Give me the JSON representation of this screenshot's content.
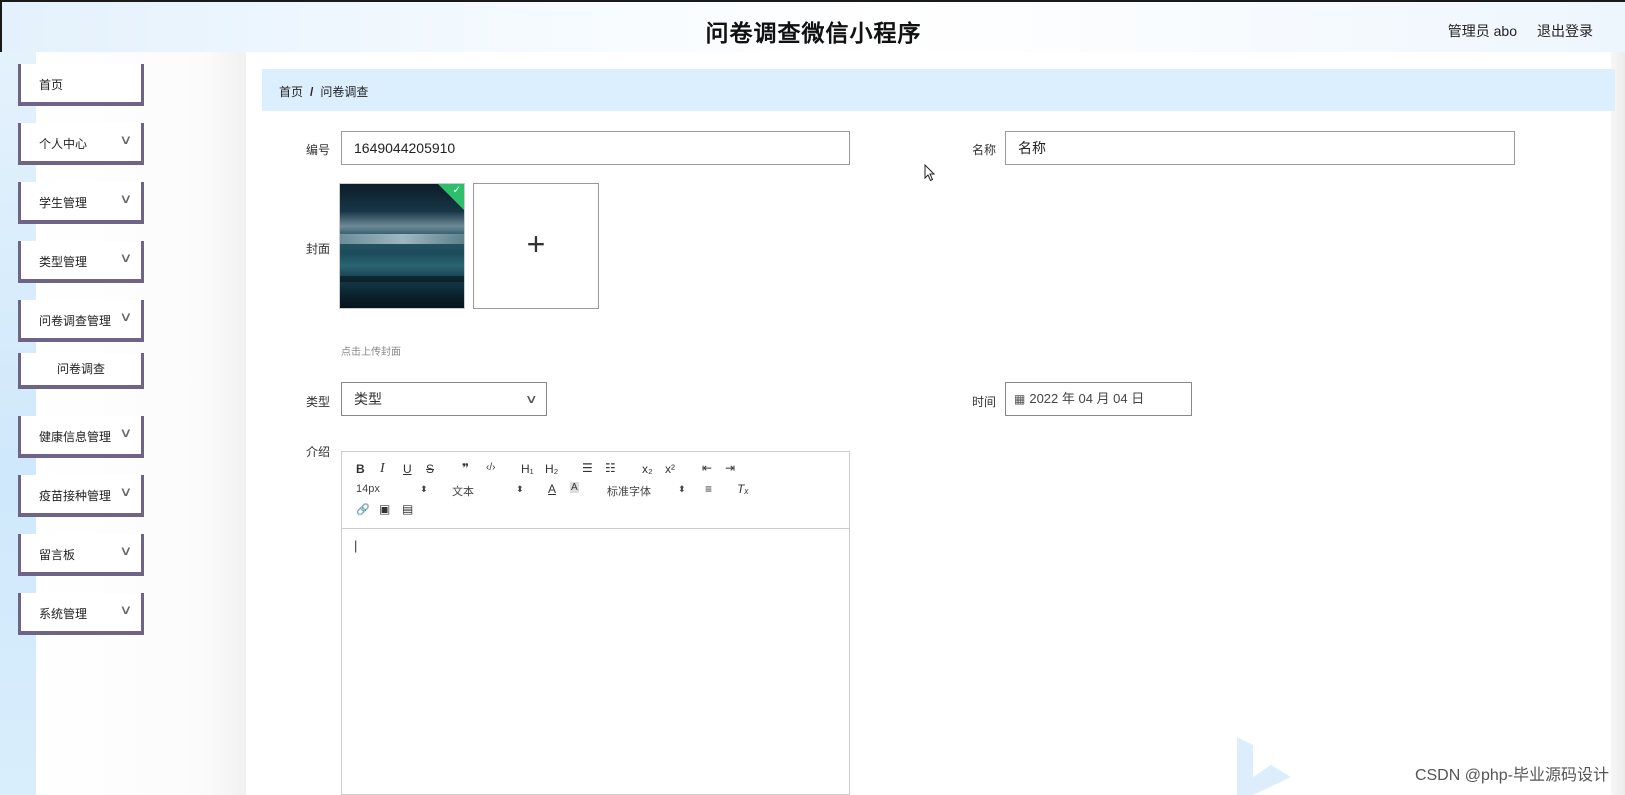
{
  "header": {
    "title": "问卷调查微信小程序",
    "user": "管理员 abo",
    "logout": "退出登录"
  },
  "sidebar": {
    "items": [
      {
        "label": "首页",
        "has_arrow": false
      },
      {
        "label": "个人中心",
        "has_arrow": true
      },
      {
        "label": "学生管理",
        "has_arrow": true
      },
      {
        "label": "类型管理",
        "has_arrow": true
      },
      {
        "label": "问卷调查管理",
        "has_arrow": true
      },
      {
        "label": "健康信息管理",
        "has_arrow": true
      },
      {
        "label": "疫苗接种管理",
        "has_arrow": true
      },
      {
        "label": "留言板",
        "has_arrow": true
      },
      {
        "label": "系统管理",
        "has_arrow": true
      }
    ],
    "submenu": {
      "label": "问卷调查"
    },
    "chevron": "∨"
  },
  "breadcrumb": {
    "home": "首页",
    "separator": "/",
    "current": "问卷调查"
  },
  "form": {
    "number": {
      "label": "编号",
      "value": "1649044205910"
    },
    "name": {
      "label": "名称",
      "value": "名称"
    },
    "cover": {
      "label": "封面",
      "hint": "点击上传封面",
      "upload_plus": "+"
    },
    "type": {
      "label": "类型",
      "value": "类型"
    },
    "time": {
      "label": "时间",
      "value": "2022 年 04 月 04 日"
    },
    "intro": {
      "label": "介绍"
    }
  },
  "editor": {
    "font_size": "14px",
    "text_type": "文本",
    "font_family": "标准字体",
    "buttons": {
      "bold": "B",
      "italic": "I",
      "underline": "U",
      "strike": "S",
      "quote": "❞",
      "code": "‹/›",
      "h1": "H₁",
      "h2": "H₂",
      "ordered_list": "☰",
      "bullet_list": "☷",
      "subscript": "x₂",
      "superscript": "x²",
      "outdent": "⇤",
      "indent": "⇥",
      "font_color": "A",
      "bg_color": "A",
      "align": "≡",
      "clear": "Tₓ",
      "link": "🔗",
      "image": "▣",
      "video": "▤"
    },
    "dropdown_glyph": "⬍",
    "content": "|"
  },
  "watermark": "CSDN @php-毕业源码设计",
  "icons": {
    "calendar": "calendar-icon",
    "cursor": "mouse-cursor-icon"
  },
  "colors": {
    "sidebar_border": "#6d6488",
    "breadcrumb_bg": "#dcefff",
    "upload_check": "#2ebf6a"
  }
}
